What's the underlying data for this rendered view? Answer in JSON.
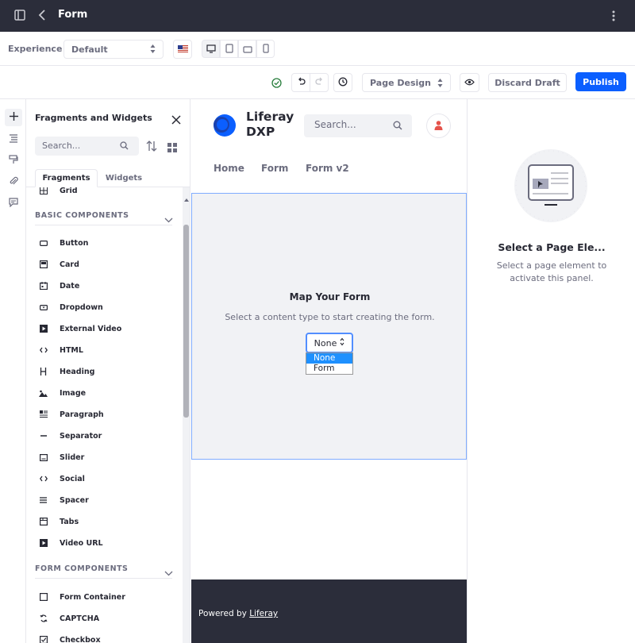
{
  "header": {
    "title": "Form"
  },
  "experience": {
    "label": "Experience",
    "selected": "Default"
  },
  "toolbar": {
    "page_design": "Page Design",
    "discard_draft": "Discard Draft",
    "publish": "Publish"
  },
  "panel": {
    "title": "Fragments and Widgets",
    "search_placeholder": "Search...",
    "tabs": [
      "Fragments",
      "Widgets"
    ],
    "partial_item": "Grid",
    "basic_components_header": "BASIC COMPONENTS",
    "basic_components": [
      "Button",
      "Card",
      "Date",
      "Dropdown",
      "External Video",
      "HTML",
      "Heading",
      "Image",
      "Paragraph",
      "Separator",
      "Slider",
      "Social",
      "Spacer",
      "Tabs",
      "Video URL"
    ],
    "form_components_header": "FORM COMPONENTS",
    "form_components": [
      "Form Container",
      "CAPTCHA",
      "Checkbox"
    ]
  },
  "canvas": {
    "brand": "Liferay DXP",
    "brand_line1": "Liferay",
    "brand_line2": "DXP",
    "search_placeholder": "Search...",
    "nav": [
      "Home",
      "Form",
      "Form v2"
    ],
    "map_title": "Map Your Form",
    "map_subtitle": "Select a content type to start creating the form.",
    "select_value": "None",
    "options": [
      "None",
      "Form"
    ],
    "footer_prefix": "Powered by",
    "footer_link": "Liferay"
  },
  "right_panel": {
    "title": "Select a Page Ele...",
    "subtitle": "Select a page element to activate this panel."
  },
  "colors": {
    "primary": "#0b5fff",
    "topbar": "#2b2d3a",
    "success": "#287d3c",
    "avatar_icon": "#e5534b"
  }
}
